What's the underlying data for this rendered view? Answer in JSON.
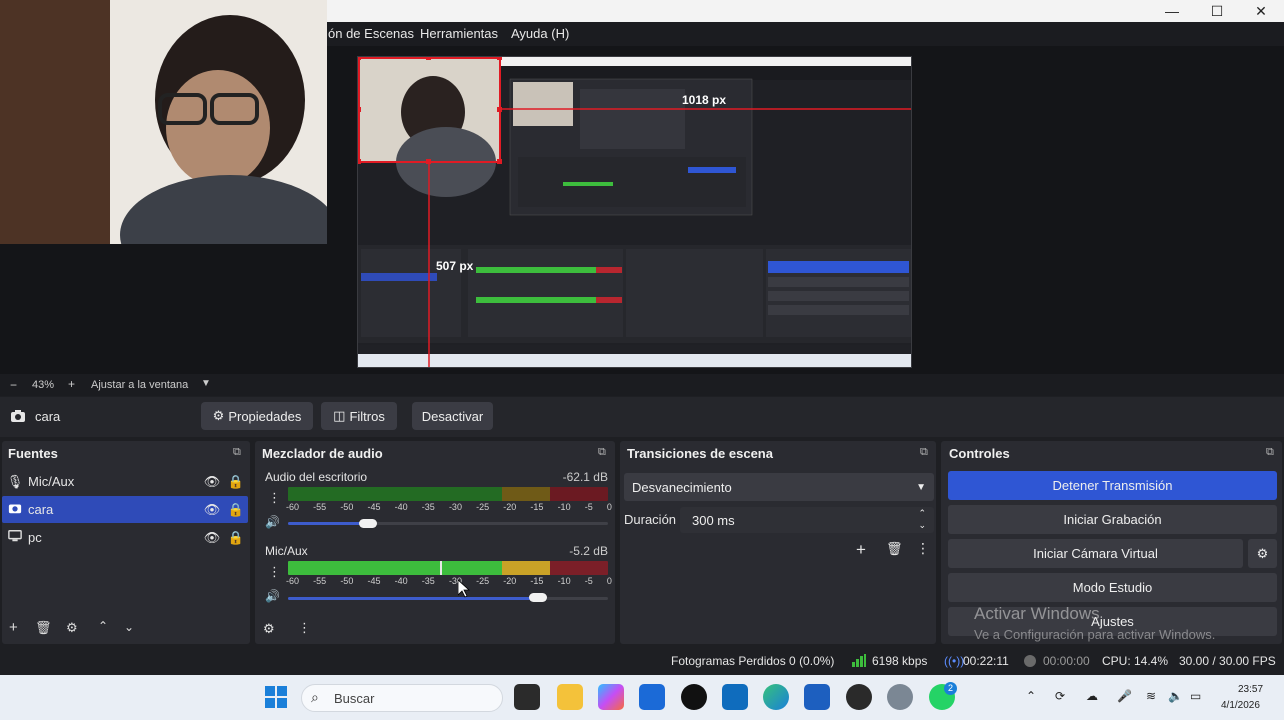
{
  "window": {
    "controls": [
      "—",
      "☐",
      "✕"
    ]
  },
  "menu": [
    "ón de Escenas",
    "Herramientas",
    "Ayuda (H)"
  ],
  "preview": {
    "measure_h": "1018 px",
    "measure_v": "507 px"
  },
  "zoom": {
    "minus": "−",
    "value": "43%",
    "plus": "+",
    "fit_label": "Ajustar a la ventana"
  },
  "source_bar": {
    "source_name": "cara",
    "properties_label": "Propiedades",
    "filters_label": "Filtros",
    "deactivate_label": "Desactivar"
  },
  "sources_dock": {
    "title": "Fuentes",
    "items": [
      {
        "name": "Mic/Aux",
        "icon": "microphone-icon",
        "selected": false
      },
      {
        "name": "cara",
        "icon": "camera-icon",
        "selected": true
      },
      {
        "name": "pc",
        "icon": "monitor-icon",
        "selected": false
      }
    ]
  },
  "mixer_dock": {
    "title": "Mezclador de audio",
    "ticks": [
      "-60",
      "-55",
      "-50",
      "-45",
      "-40",
      "-35",
      "-30",
      "-25",
      "-20",
      "-15",
      "-10",
      "-5",
      "0"
    ],
    "channels": [
      {
        "name": "Audio del escritorio",
        "db": "-62.1 dB",
        "level": 0.0,
        "volume": 0.25
      },
      {
        "name": "Mic/Aux",
        "db": "-5.2 dB",
        "level": 0.92,
        "volume": 0.78
      }
    ]
  },
  "transitions_dock": {
    "title": "Transiciones de escena",
    "transition": "Desvanecimiento",
    "duration_label": "Duración",
    "duration_value": "300 ms"
  },
  "controls_dock": {
    "title": "Controles",
    "stop_stream": "Detener Transmisión",
    "start_recording": "Iniciar Grabación",
    "start_virtual_cam": "Iniciar Cámara Virtual",
    "studio_mode": "Modo Estudio",
    "settings": "Ajustes",
    "watermark_title": "Activar Windows",
    "watermark_sub": "Ve a Configuración para activar Windows."
  },
  "status": {
    "dropped_frames": "Fotogramas Perdidos 0 (0.0%)",
    "bitrate": "6198 kbps",
    "stream_time": "00:22:11",
    "rec_time": "00:00:00",
    "cpu": "CPU: 14.4%",
    "fps": "30.00 / 30.00 FPS"
  },
  "taskbar": {
    "search_placeholder": "Buscar",
    "time": "23:57",
    "date": "4/1/2026",
    "whatsapp_badge": "2"
  },
  "colors": {
    "accent": "#2f56d4",
    "selection": "#2f4bb8",
    "meter_green": "#3dbd3d",
    "meter_yellow": "#c9a227",
    "meter_red": "#b8262f"
  }
}
